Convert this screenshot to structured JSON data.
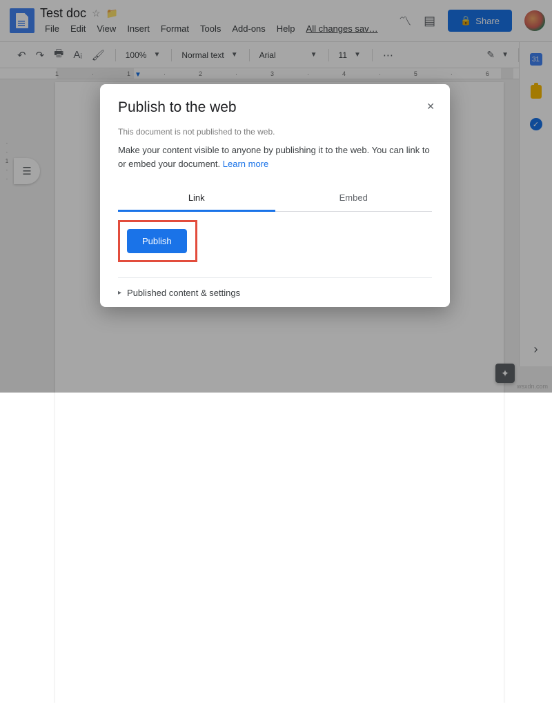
{
  "header": {
    "title": "Test doc",
    "menus": [
      "File",
      "Edit",
      "View",
      "Insert",
      "Format",
      "Tools",
      "Add-ons",
      "Help"
    ],
    "save_status": "All changes sav…",
    "share_label": "Share"
  },
  "toolbar": {
    "zoom": "100%",
    "style": "Normal text",
    "font": "Arial",
    "size": "11"
  },
  "ruler_ticks": [
    "1",
    "",
    "1",
    "",
    "2",
    "",
    "3",
    "",
    "4",
    "",
    "5",
    "",
    "6",
    ""
  ],
  "side_panel": {
    "calendar": "31"
  },
  "dialog": {
    "title": "Publish to the web",
    "subtitle": "This document is not published to the web.",
    "description": "Make your content visible to anyone by publishing it to the web. You can link to or embed your document. ",
    "learn_more": "Learn more",
    "tabs": {
      "link": "Link",
      "embed": "Embed"
    },
    "publish_label": "Publish",
    "expand_label": "Published content & settings"
  },
  "watermark": "wsxdn.com"
}
